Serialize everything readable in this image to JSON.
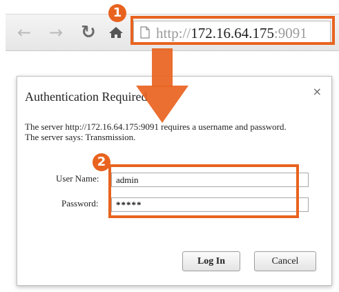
{
  "browser": {
    "nav": {
      "back_icon": "arrow-left",
      "forward_icon": "arrow-right",
      "reload_icon": "reload",
      "home_icon": "home"
    },
    "address": {
      "scheme": "http://",
      "host": "172.16.64.175",
      "port": ":9091"
    }
  },
  "callouts": {
    "step1": "1",
    "step2": "2"
  },
  "dialog": {
    "title": "Authentication Required",
    "close": "×",
    "message": "The server http://172.16.64.175:9091 requires a username and password. The server says: Transmission.",
    "username_label": "User Name:",
    "username_value": "admin",
    "password_label": "Password:",
    "password_value": "*****",
    "login_label": "Log In",
    "cancel_label": "Cancel"
  },
  "colors": {
    "accent": "#e8631f",
    "toolbar": "#ececec",
    "dialog_border": "#bfbfbf"
  }
}
